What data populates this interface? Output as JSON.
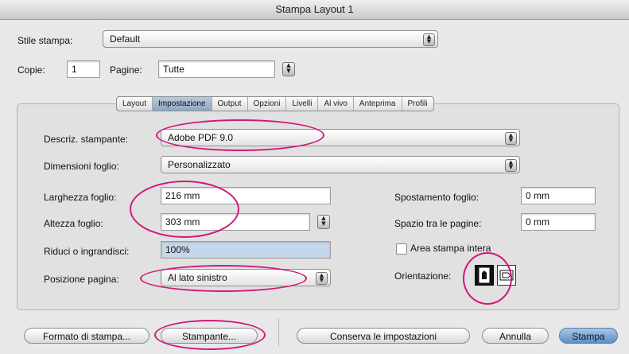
{
  "window": {
    "title": "Stampa Layout 1"
  },
  "header": {
    "style_label": "Stile stampa:",
    "style_value": "Default",
    "copies_label": "Copie:",
    "copies_value": "1",
    "pages_label": "Pagine:",
    "pages_value": "Tutte"
  },
  "tabs": [
    {
      "label": "Layout"
    },
    {
      "label": "Impostazione",
      "active": true
    },
    {
      "label": "Output"
    },
    {
      "label": "Opzioni"
    },
    {
      "label": "Livelli"
    },
    {
      "label": "Al vivo"
    },
    {
      "label": "Anteprima"
    },
    {
      "label": "Profili"
    }
  ],
  "setup": {
    "printer_desc_label": "Descriz. stampante:",
    "printer_desc_value": "Adobe PDF 9.0",
    "paper_size_label": "Dimensioni foglio:",
    "paper_size_value": "Personalizzato",
    "width_label": "Larghezza foglio:",
    "width_value": "216 mm",
    "height_label": "Altezza foglio:",
    "height_value": "303 mm",
    "scale_label": "Riduci o ingrandisci:",
    "scale_value": "100%",
    "position_label": "Posizione pagina:",
    "position_value": "Al lato sinistro",
    "offset_label": "Spostamento foglio:",
    "offset_value": "0 mm",
    "gap_label": "Spazio tra le pagine:",
    "gap_value": "0 mm",
    "full_area_label": "Area stampa intera",
    "full_area_checked": false,
    "orientation_label": "Orientazione:",
    "orientation_options": [
      "portrait-icon",
      "landscape-icon"
    ],
    "orientation_selected": "portrait-icon"
  },
  "footer": {
    "page_setup_label": "Formato di stampa...",
    "printer_label": "Stampante...",
    "save_settings_label": "Conserva le impostazioni",
    "cancel_label": "Annulla",
    "print_label": "Stampa"
  },
  "colors": {
    "highlight": "#d0187a",
    "default_button": "#5c8fc7",
    "active_tab": "#8ea6c3"
  }
}
